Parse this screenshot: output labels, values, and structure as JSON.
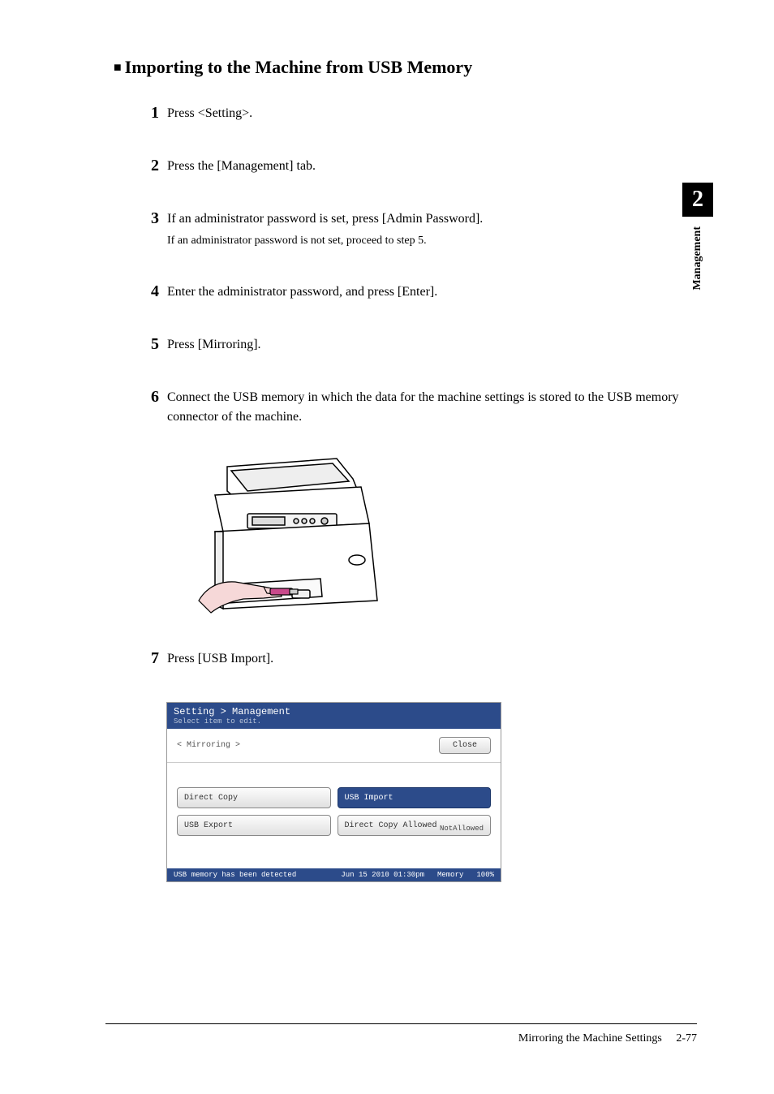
{
  "sideTab": {
    "number": "2",
    "label": "Management"
  },
  "title": "Importing to the Machine from USB Memory",
  "steps": [
    {
      "num": "1",
      "text": "Press <Setting>.",
      "sub": ""
    },
    {
      "num": "2",
      "text": "Press the [Management] tab.",
      "sub": ""
    },
    {
      "num": "3",
      "text": "If an administrator password is set, press [Admin Password].",
      "sub": "If an administrator password is not set, proceed to step 5."
    },
    {
      "num": "4",
      "text": "Enter the administrator password, and press [Enter].",
      "sub": ""
    },
    {
      "num": "5",
      "text": "Press [Mirroring].",
      "sub": ""
    },
    {
      "num": "6",
      "text": "Connect the USB memory in which the data for the machine settings is stored to the USB memory connector of the machine.",
      "sub": ""
    },
    {
      "num": "7",
      "text": "Press [USB Import].",
      "sub": ""
    }
  ],
  "panel": {
    "breadcrumb": "Setting > Management",
    "subtitle": "Select item to edit.",
    "sectionLabel": "< Mirroring >",
    "closeLabel": "Close",
    "options": {
      "directCopy": "Direct Copy",
      "usbImport": "USB Import",
      "usbExport": "USB Export",
      "directCopyAllowed": "Direct Copy Allowed",
      "directCopyAllowedValue": "NotAllowed"
    },
    "statusLeft": "USB memory has been detected",
    "statusDate": "Jun 15 2010 01:30pm",
    "statusMemory": "Memory",
    "statusPercent": "100%"
  },
  "footer": {
    "title": "Mirroring the Machine Settings",
    "pageNum": "2-77"
  }
}
